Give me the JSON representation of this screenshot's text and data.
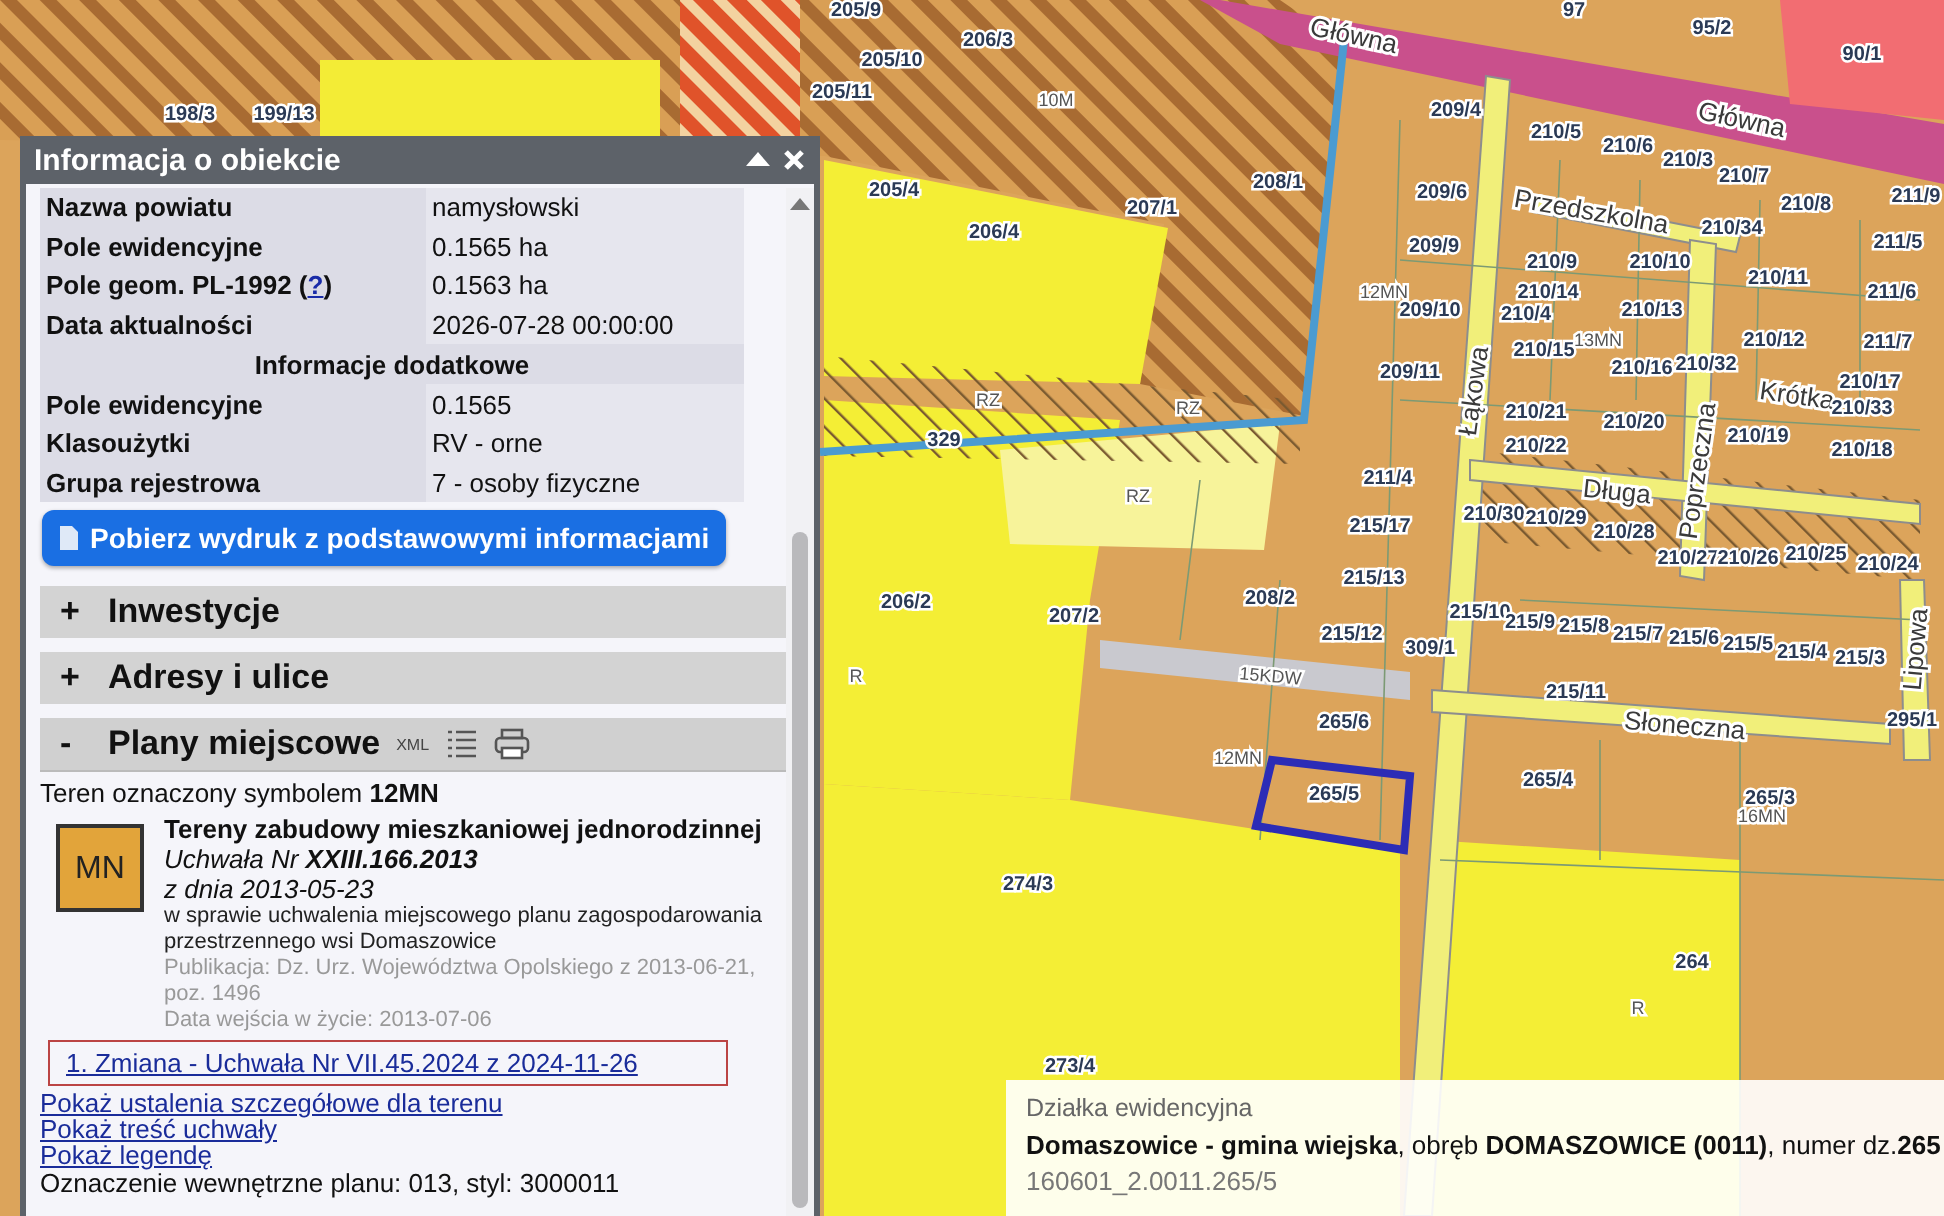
{
  "panel": {
    "title": "Informacja o obiekcie"
  },
  "rows": [
    {
      "kind": "row",
      "label": "Nazwa powiatu",
      "value": "namysłowski"
    },
    {
      "kind": "row",
      "label": "Pole ewidencyjne",
      "value": "0.1565 ha"
    },
    {
      "kind": "row",
      "label": "Pole geom. PL-1992 (",
      "link": "?",
      "label_end": ")",
      "value": "0.1563 ha"
    },
    {
      "kind": "row",
      "label": "Data aktualności",
      "value": "2026-07-28 00:00:00"
    },
    {
      "kind": "header",
      "label": "Informacje dodatkowe"
    },
    {
      "kind": "row",
      "label": "Pole ewidencyjne",
      "value": "0.1565"
    },
    {
      "kind": "row",
      "label": "Klasoużytki",
      "value": "RV - orne"
    },
    {
      "kind": "row",
      "label": "Grupa rejestrowa",
      "value": "7 - osoby fizyczne"
    }
  ],
  "download_button": "Pobierz wydruk z podstawowymi informacjami",
  "sections": [
    {
      "sign": "+",
      "title": "Inwestycje",
      "expanded": false
    },
    {
      "sign": "+",
      "title": "Adresy i ulice",
      "expanded": false
    },
    {
      "sign": "-",
      "title": "Plany miejscowe",
      "expanded": true,
      "xml": "XML"
    }
  ],
  "plan": {
    "symbol_line": "Teren oznaczony symbolem **12MN**",
    "badge": "MN",
    "title": "Tereny zabudowy mieszkaniowej jednorodzinnej",
    "resolution": "Uchwała Nr **XXIII.166.2013**",
    "date": "z dnia 2013-05-23",
    "subject": "w sprawie uchwalenia miejscowego planu zagospodarowania przestrzennego wsi Domaszowice",
    "publication": "Publikacja: Dz. Urz. Województwa Opolskiego z 2013-06-21, poz. 1496",
    "effective": "Data wejścia w życie: 2013-07-06",
    "change": "1. Zmiana - Uchwała Nr VII.45.2024 z 2024-11-26",
    "links": [
      "Pokaż ustalenia szczegółowe dla terenu",
      "Pokaż treść uchwały",
      "Pokaż legendę"
    ],
    "internal": "Oznaczenie wewnętrzne planu: 013, styl: 3000011"
  },
  "popup": {
    "heading": "Działka ewidencyjna",
    "description": "**Domaszowice - gmina wiejska**, obręb **DOMASZOWICE (0011)**, numer dz.**265**",
    "identifier": "160601_2.0011.265/5"
  },
  "map_labels": [
    {
      "kind": "parcel",
      "text": "198/3"
    },
    {
      "kind": "parcel",
      "text": "199/13"
    },
    {
      "kind": "parcel",
      "text": "205/9"
    },
    {
      "kind": "parcel",
      "text": "206/3"
    },
    {
      "kind": "parcel",
      "text": "205/10"
    },
    {
      "kind": "parcel",
      "text": "205/11"
    },
    {
      "kind": "zone",
      "text": "10M"
    },
    {
      "kind": "parcel",
      "text": "97"
    },
    {
      "kind": "parcel",
      "text": "95/2"
    },
    {
      "kind": "parcel",
      "text": "90/1"
    },
    {
      "kind": "street",
      "text": "Główna"
    },
    {
      "kind": "street",
      "text": "Główna"
    },
    {
      "kind": "parcel",
      "text": "209/4"
    },
    {
      "kind": "parcel",
      "text": "205/4"
    },
    {
      "kind": "parcel",
      "text": "206/4"
    },
    {
      "kind": "parcel",
      "text": "207/1"
    },
    {
      "kind": "parcel",
      "text": "208/1"
    },
    {
      "kind": "parcel",
      "text": "210/5"
    },
    {
      "kind": "parcel",
      "text": "210/6"
    },
    {
      "kind": "parcel",
      "text": "210/3"
    },
    {
      "kind": "parcel",
      "text": "210/7"
    },
    {
      "kind": "parcel",
      "text": "209/6"
    },
    {
      "kind": "parcel",
      "text": "210/8"
    },
    {
      "kind": "parcel",
      "text": "211/9"
    },
    {
      "kind": "street",
      "text": "Przedszkolna"
    },
    {
      "kind": "parcel",
      "text": "210/34"
    },
    {
      "kind": "parcel",
      "text": "210/9"
    },
    {
      "kind": "parcel",
      "text": "210/10"
    },
    {
      "kind": "parcel",
      "text": "209/9"
    },
    {
      "kind": "zone",
      "text": "12MN"
    },
    {
      "kind": "parcel",
      "text": "211/5"
    },
    {
      "kind": "parcel",
      "text": "210/11"
    },
    {
      "kind": "parcel",
      "text": "211/6"
    },
    {
      "kind": "parcel",
      "text": "209/10"
    },
    {
      "kind": "parcel",
      "text": "210/14"
    },
    {
      "kind": "parcel",
      "text": "210/4"
    },
    {
      "kind": "parcel",
      "text": "210/13"
    },
    {
      "kind": "street",
      "text": "Łąkowa"
    },
    {
      "kind": "parcel",
      "text": "210/15"
    },
    {
      "kind": "zone",
      "text": "13MN"
    },
    {
      "kind": "parcel",
      "text": "210/12"
    },
    {
      "kind": "parcel",
      "text": "211/7"
    },
    {
      "kind": "parcel",
      "text": "209/11"
    },
    {
      "kind": "parcel",
      "text": "210/16"
    },
    {
      "kind": "parcel",
      "text": "210/32"
    },
    {
      "kind": "parcel",
      "text": "210/17"
    },
    {
      "kind": "zone",
      "text": "RZ"
    },
    {
      "kind": "zone",
      "text": "RZ"
    },
    {
      "kind": "parcel",
      "text": "210/21"
    },
    {
      "kind": "parcel",
      "text": "210/20"
    },
    {
      "kind": "street",
      "text": "Krótka"
    },
    {
      "kind": "parcel",
      "text": "210/33"
    },
    {
      "kind": "parcel",
      "text": "329"
    },
    {
      "kind": "parcel",
      "text": "210/22"
    },
    {
      "kind": "parcel",
      "text": "210/19"
    },
    {
      "kind": "parcel",
      "text": "210/18"
    },
    {
      "kind": "zone",
      "text": "RZ"
    },
    {
      "kind": "parcel",
      "text": "211/4"
    },
    {
      "kind": "street",
      "text": "Długa"
    },
    {
      "kind": "parcel",
      "text": "215/17"
    },
    {
      "kind": "parcel",
      "text": "210/30"
    },
    {
      "kind": "parcel",
      "text": "210/29"
    },
    {
      "kind": "parcel",
      "text": "210/28"
    },
    {
      "kind": "parcel",
      "text": "210/27"
    },
    {
      "kind": "parcel",
      "text": "210/26"
    },
    {
      "kind": "parcel",
      "text": "210/25"
    },
    {
      "kind": "parcel",
      "text": "210/24"
    },
    {
      "kind": "street",
      "text": "Poprzeczna"
    },
    {
      "kind": "parcel",
      "text": "215/13"
    },
    {
      "kind": "parcel",
      "text": "206/2"
    },
    {
      "kind": "parcel",
      "text": "207/2"
    },
    {
      "kind": "parcel",
      "text": "208/2"
    },
    {
      "kind": "parcel",
      "text": "215/10"
    },
    {
      "kind": "parcel",
      "text": "215/9"
    },
    {
      "kind": "parcel",
      "text": "215/8"
    },
    {
      "kind": "parcel",
      "text": "215/7"
    },
    {
      "kind": "parcel",
      "text": "215/6"
    },
    {
      "kind": "parcel",
      "text": "215/5"
    },
    {
      "kind": "parcel",
      "text": "215/4"
    },
    {
      "kind": "parcel",
      "text": "215/3"
    },
    {
      "kind": "parcel",
      "text": "215/12"
    },
    {
      "kind": "parcel",
      "text": "309/1"
    },
    {
      "kind": "zone",
      "text": "R"
    },
    {
      "kind": "zone",
      "text": "15KDW"
    },
    {
      "kind": "parcel",
      "text": "265/6"
    },
    {
      "kind": "parcel",
      "text": "215/11"
    },
    {
      "kind": "street",
      "text": "Słoneczna"
    },
    {
      "kind": "parcel",
      "text": "295/1"
    },
    {
      "kind": "zone",
      "text": "12MN"
    },
    {
      "kind": "parcel",
      "text": "265/5"
    },
    {
      "kind": "parcel",
      "text": "265/4"
    },
    {
      "kind": "parcel",
      "text": "265/3"
    },
    {
      "kind": "zone",
      "text": "16MN"
    },
    {
      "kind": "parcel",
      "text": "274/3"
    },
    {
      "kind": "parcel",
      "text": "264"
    },
    {
      "kind": "zone",
      "text": "R"
    },
    {
      "kind": "parcel",
      "text": "273/4"
    },
    {
      "kind": "street",
      "text": "Lipowa"
    }
  ]
}
